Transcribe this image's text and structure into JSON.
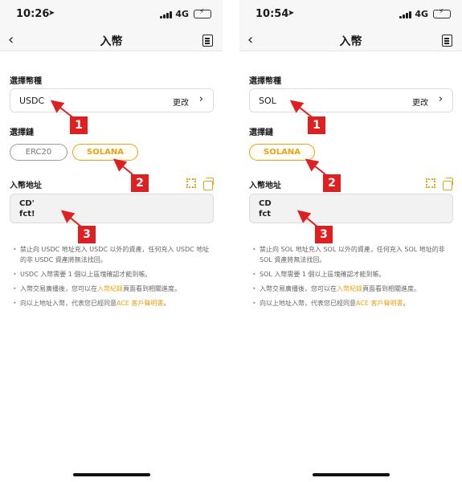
{
  "screens": [
    {
      "status": {
        "time": "10:26",
        "network": "4G"
      },
      "nav": {
        "back_glyph": "‹",
        "title": "入幣"
      },
      "coin_section": {
        "label": "選擇幣種",
        "value": "USDC",
        "change": "更改",
        "chev": "›"
      },
      "chain_section": {
        "label": "選擇鏈",
        "chips": [
          "ERC20",
          "SOLANA"
        ],
        "selected": "SOLANA"
      },
      "address_section": {
        "label": "入幣地址",
        "line1": "CD'",
        "line2": "fct!"
      },
      "notes": {
        "n1": "禁止向 USDC 地址充入 USDC 以外的資產，任何充入 USDC 地址的非 USDC 資產將無法找回。",
        "n2": "USDC 入幣需要 1 個以上區塊確認才能到帳。",
        "n3_pre": "入幣交易廣播後，您可以在",
        "n3_link": "入幣紀錄",
        "n3_post": "頁面看到相關進度。",
        "n4_pre": "向以上地址入幣，代表您已經同意",
        "n4_link": "ACE 客戶聲明書",
        "n4_post": "。"
      }
    },
    {
      "status": {
        "time": "10:54",
        "network": "4G"
      },
      "nav": {
        "back_glyph": "‹",
        "title": "入幣"
      },
      "coin_section": {
        "label": "選擇幣種",
        "value": "SOL",
        "change": "更改",
        "chev": "›"
      },
      "chain_section": {
        "label": "選擇鏈",
        "chips": [
          "SOLANA"
        ],
        "selected": "SOLANA"
      },
      "address_section": {
        "label": "入幣地址",
        "line1": "CD",
        "line2": "fct"
      },
      "notes": {
        "n1": "禁止向 SOL 地址充入 SOL 以外的資產，任何充入 SOL 地址的非 SOL 資產將無法找回。",
        "n2": "SOL 入幣需要 1 個以上區塊確認才能到帳。",
        "n3_pre": "入幣交易廣播後，您可以在",
        "n3_link": "入幣紀錄",
        "n3_post": "頁面看到相關進度。",
        "n4_pre": "向以上地址入幣，代表您已經同意",
        "n4_link": "ACE 客戶聲明書",
        "n4_post": "。"
      }
    }
  ],
  "annotations": [
    "1",
    "2",
    "3"
  ],
  "colors": {
    "accent": "#e6a519",
    "annotation": "#e02020"
  }
}
